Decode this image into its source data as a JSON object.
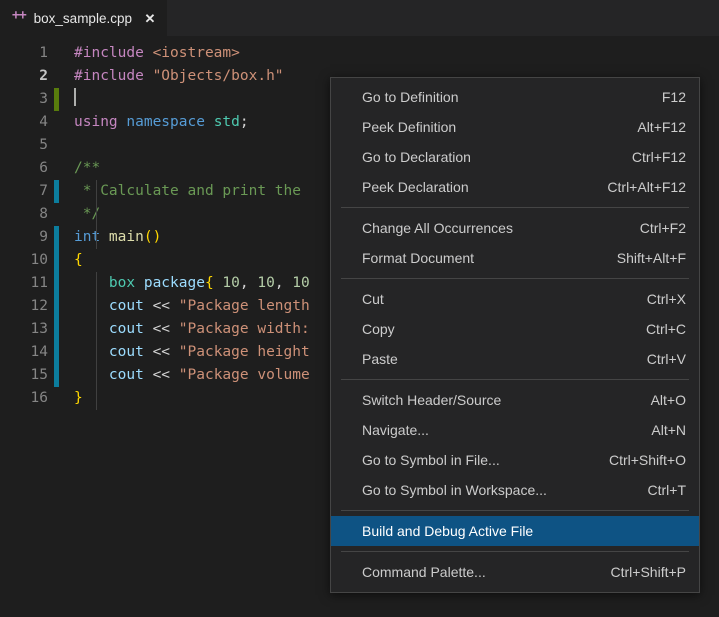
{
  "window": {
    "background": "#1e1e1e",
    "accent": "#0e5384"
  },
  "tabbar": {
    "tabs": [
      {
        "icon": "cpp-file-icon",
        "icon_glyph": "++",
        "label": "box_sample.cpp",
        "close_glyph": "✕",
        "active": true
      }
    ]
  },
  "editor": {
    "lines": [
      {
        "number": "1",
        "gutter": "none",
        "current": false,
        "tokens": [
          {
            "t": "#include ",
            "c": "t-pre"
          },
          {
            "t": "<iostream>",
            "c": "t-str"
          }
        ]
      },
      {
        "number": "2",
        "gutter": "none",
        "current": true,
        "tokens": [
          {
            "t": "#include ",
            "c": "t-pre"
          },
          {
            "t": "\"Objects/box.h\"",
            "c": "t-str"
          }
        ]
      },
      {
        "number": "3",
        "gutter": "added",
        "current": false,
        "caret": true,
        "tokens": []
      },
      {
        "number": "4",
        "gutter": "none",
        "current": false,
        "tokens": [
          {
            "t": "using ",
            "c": "t-pre"
          },
          {
            "t": "namespace ",
            "c": "t-kw"
          },
          {
            "t": "std",
            "c": "t-type"
          },
          {
            "t": ";",
            "c": "t-plain"
          }
        ]
      },
      {
        "number": "5",
        "gutter": "none",
        "current": false,
        "tokens": []
      },
      {
        "number": "6",
        "gutter": "none",
        "current": false,
        "tokens": [
          {
            "t": "/**",
            "c": "t-cmt"
          }
        ]
      },
      {
        "number": "7",
        "gutter": "modified",
        "current": false,
        "tokens": [
          {
            "t": " * Calculate and print the",
            "c": "t-cmt"
          }
        ]
      },
      {
        "number": "8",
        "gutter": "none",
        "current": false,
        "tokens": [
          {
            "t": " */",
            "c": "t-cmt"
          }
        ]
      },
      {
        "number": "9",
        "gutter": "modified",
        "current": false,
        "tokens": [
          {
            "t": "int ",
            "c": "t-kw"
          },
          {
            "t": "main",
            "c": "t-fn"
          },
          {
            "t": "()",
            "c": "t-punct"
          }
        ]
      },
      {
        "number": "10",
        "gutter": "modified",
        "current": false,
        "tokens": [
          {
            "t": "{",
            "c": "t-punct"
          }
        ]
      },
      {
        "number": "11",
        "gutter": "modified",
        "current": false,
        "tokens": [
          {
            "t": "    ",
            "c": "t-plain"
          },
          {
            "t": "box ",
            "c": "t-type"
          },
          {
            "t": "package",
            "c": "t-var"
          },
          {
            "t": "{ ",
            "c": "t-punct"
          },
          {
            "t": "10",
            "c": "t-num"
          },
          {
            "t": ", ",
            "c": "t-plain"
          },
          {
            "t": "10",
            "c": "t-num"
          },
          {
            "t": ", ",
            "c": "t-plain"
          },
          {
            "t": "10",
            "c": "t-num"
          }
        ]
      },
      {
        "number": "12",
        "gutter": "modified",
        "current": false,
        "tokens": [
          {
            "t": "    ",
            "c": "t-plain"
          },
          {
            "t": "cout ",
            "c": "t-var"
          },
          {
            "t": "<< ",
            "c": "t-plain"
          },
          {
            "t": "\"Package length",
            "c": "t-str"
          }
        ]
      },
      {
        "number": "13",
        "gutter": "modified",
        "current": false,
        "tokens": [
          {
            "t": "    ",
            "c": "t-plain"
          },
          {
            "t": "cout ",
            "c": "t-var"
          },
          {
            "t": "<< ",
            "c": "t-plain"
          },
          {
            "t": "\"Package width:",
            "c": "t-str"
          }
        ]
      },
      {
        "number": "14",
        "gutter": "modified",
        "current": false,
        "tokens": [
          {
            "t": "    ",
            "c": "t-plain"
          },
          {
            "t": "cout ",
            "c": "t-var"
          },
          {
            "t": "<< ",
            "c": "t-plain"
          },
          {
            "t": "\"Package height",
            "c": "t-str"
          }
        ]
      },
      {
        "number": "15",
        "gutter": "modified",
        "current": false,
        "tokens": [
          {
            "t": "    ",
            "c": "t-plain"
          },
          {
            "t": "cout ",
            "c": "t-var"
          },
          {
            "t": "<< ",
            "c": "t-plain"
          },
          {
            "t": "\"Package volume",
            "c": "t-str"
          }
        ]
      },
      {
        "number": "16",
        "gutter": "none",
        "current": false,
        "tokens": [
          {
            "t": "}",
            "c": "t-punct"
          }
        ]
      }
    ]
  },
  "context_menu": {
    "items": [
      {
        "kind": "item",
        "label": "Go to Definition",
        "key": "F12",
        "selected": false
      },
      {
        "kind": "item",
        "label": "Peek Definition",
        "key": "Alt+F12",
        "selected": false
      },
      {
        "kind": "item",
        "label": "Go to Declaration",
        "key": "Ctrl+F12",
        "selected": false
      },
      {
        "kind": "item",
        "label": "Peek Declaration",
        "key": "Ctrl+Alt+F12",
        "selected": false
      },
      {
        "kind": "separator"
      },
      {
        "kind": "item",
        "label": "Change All Occurrences",
        "key": "Ctrl+F2",
        "selected": false
      },
      {
        "kind": "item",
        "label": "Format Document",
        "key": "Shift+Alt+F",
        "selected": false
      },
      {
        "kind": "separator"
      },
      {
        "kind": "item",
        "label": "Cut",
        "key": "Ctrl+X",
        "selected": false
      },
      {
        "kind": "item",
        "label": "Copy",
        "key": "Ctrl+C",
        "selected": false
      },
      {
        "kind": "item",
        "label": "Paste",
        "key": "Ctrl+V",
        "selected": false
      },
      {
        "kind": "separator"
      },
      {
        "kind": "item",
        "label": "Switch Header/Source",
        "key": "Alt+O",
        "selected": false
      },
      {
        "kind": "item",
        "label": "Navigate...",
        "key": "Alt+N",
        "selected": false
      },
      {
        "kind": "item",
        "label": "Go to Symbol in File...",
        "key": "Ctrl+Shift+O",
        "selected": false
      },
      {
        "kind": "item",
        "label": "Go to Symbol in Workspace...",
        "key": "Ctrl+T",
        "selected": false
      },
      {
        "kind": "separator"
      },
      {
        "kind": "item",
        "label": "Build and Debug Active File",
        "key": "",
        "selected": true
      },
      {
        "kind": "separator"
      },
      {
        "kind": "item",
        "label": "Command Palette...",
        "key": "Ctrl+Shift+P",
        "selected": false
      }
    ]
  }
}
